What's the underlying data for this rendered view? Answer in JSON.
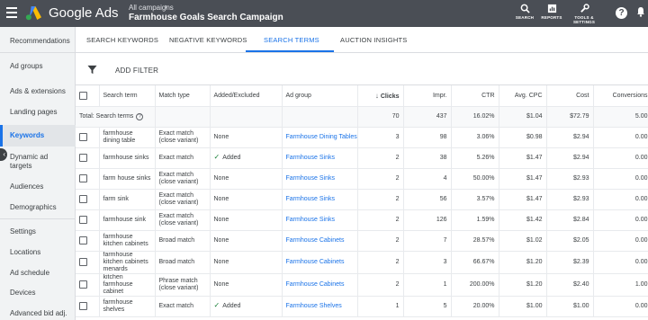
{
  "header": {
    "brand": "Google Ads",
    "breadcrumb": "All campaigns",
    "campaign_title": "Farmhouse Goals Search Campaign",
    "actions": [
      {
        "label": "SEARCH",
        "icon": "search-icon"
      },
      {
        "label": "REPORTS",
        "icon": "reports-icon"
      },
      {
        "label": "TOOLS &\nSETTINGS",
        "icon": "wrench-icon"
      }
    ],
    "help_icon": "help-icon",
    "notification_icon": "bell-icon"
  },
  "sidebar": {
    "items": [
      {
        "label": "Recommendations"
      },
      {
        "label": "Ad groups"
      },
      {
        "label": "Ads & extensions"
      },
      {
        "label": "Landing pages"
      },
      {
        "label": "Keywords",
        "active": true
      },
      {
        "label": "Dynamic ad targets"
      },
      {
        "label": "Audiences"
      },
      {
        "label": "Demographics"
      },
      {
        "label": "Settings"
      },
      {
        "label": "Locations"
      },
      {
        "label": "Ad schedule"
      },
      {
        "label": "Devices"
      },
      {
        "label": "Advanced bid adj."
      }
    ]
  },
  "tabs": [
    {
      "label": "SEARCH KEYWORDS"
    },
    {
      "label": "NEGATIVE KEYWORDS"
    },
    {
      "label": "SEARCH TERMS",
      "active": true
    },
    {
      "label": "AUCTION INSIGHTS"
    }
  ],
  "filter": {
    "label": "ADD FILTER"
  },
  "table": {
    "columns": [
      "Search term",
      "Match type",
      "Added/Excluded",
      "Ad group",
      "Clicks",
      "Impr.",
      "CTR",
      "Avg. CPC",
      "Cost",
      "Conversions"
    ],
    "total": {
      "label": "Total: Search terms",
      "clicks": "70",
      "impr": "437",
      "ctr": "16.02%",
      "cpc": "$1.04",
      "cost": "$72.79",
      "conv": "5.00"
    },
    "rows": [
      {
        "term": "farmhouse dining table",
        "match": "Exact match (close variant)",
        "added": "None",
        "ad_group": "Farmhouse Dining Tables",
        "clicks": "3",
        "impr": "98",
        "ctr": "3.06%",
        "cpc": "$0.98",
        "cost": "$2.94",
        "conv": "0.00"
      },
      {
        "term": "farmhouse sinks",
        "match": "Exact match",
        "added": "Added",
        "ad_group": "Farmhouse Sinks",
        "clicks": "2",
        "impr": "38",
        "ctr": "5.26%",
        "cpc": "$1.47",
        "cost": "$2.94",
        "conv": "0.00"
      },
      {
        "term": "farm house sinks",
        "match": "Exact match (close variant)",
        "added": "None",
        "ad_group": "Farmhouse Sinks",
        "clicks": "2",
        "impr": "4",
        "ctr": "50.00%",
        "cpc": "$1.47",
        "cost": "$2.93",
        "conv": "0.00"
      },
      {
        "term": "farm sink",
        "match": "Exact match (close variant)",
        "added": "None",
        "ad_group": "Farmhouse Sinks",
        "clicks": "2",
        "impr": "56",
        "ctr": "3.57%",
        "cpc": "$1.47",
        "cost": "$2.93",
        "conv": "0.00"
      },
      {
        "term": "farmhouse sink",
        "match": "Exact match (close variant)",
        "added": "None",
        "ad_group": "Farmhouse Sinks",
        "clicks": "2",
        "impr": "126",
        "ctr": "1.59%",
        "cpc": "$1.42",
        "cost": "$2.84",
        "conv": "0.00"
      },
      {
        "term": "farmhouse kitchen cabinets",
        "match": "Broad match",
        "added": "None",
        "ad_group": "Farmhouse Cabinets",
        "clicks": "2",
        "impr": "7",
        "ctr": "28.57%",
        "cpc": "$1.02",
        "cost": "$2.05",
        "conv": "0.00"
      },
      {
        "term": "farmhouse kitchen cabinets menards",
        "match": "Broad match",
        "added": "None",
        "ad_group": "Farmhouse Cabinets",
        "clicks": "2",
        "impr": "3",
        "ctr": "66.67%",
        "cpc": "$1.20",
        "cost": "$2.39",
        "conv": "0.00"
      },
      {
        "term": "kitchen farmhouse cabinet",
        "match": "Phrase match (close variant)",
        "added": "None",
        "ad_group": "Farmhouse Cabinets",
        "clicks": "2",
        "impr": "1",
        "ctr": "200.00%",
        "cpc": "$1.20",
        "cost": "$2.40",
        "conv": "1.00"
      },
      {
        "term": "farmhouse shelves",
        "match": "Exact match",
        "added": "Added",
        "ad_group": "Farmhouse Shelves",
        "clicks": "1",
        "impr": "5",
        "ctr": "20.00%",
        "cpc": "$1.00",
        "cost": "$1.00",
        "conv": "0.00"
      }
    ]
  },
  "colors": {
    "topbar": "#4a4e55",
    "accent": "#1a73e8",
    "added": "#188038"
  }
}
